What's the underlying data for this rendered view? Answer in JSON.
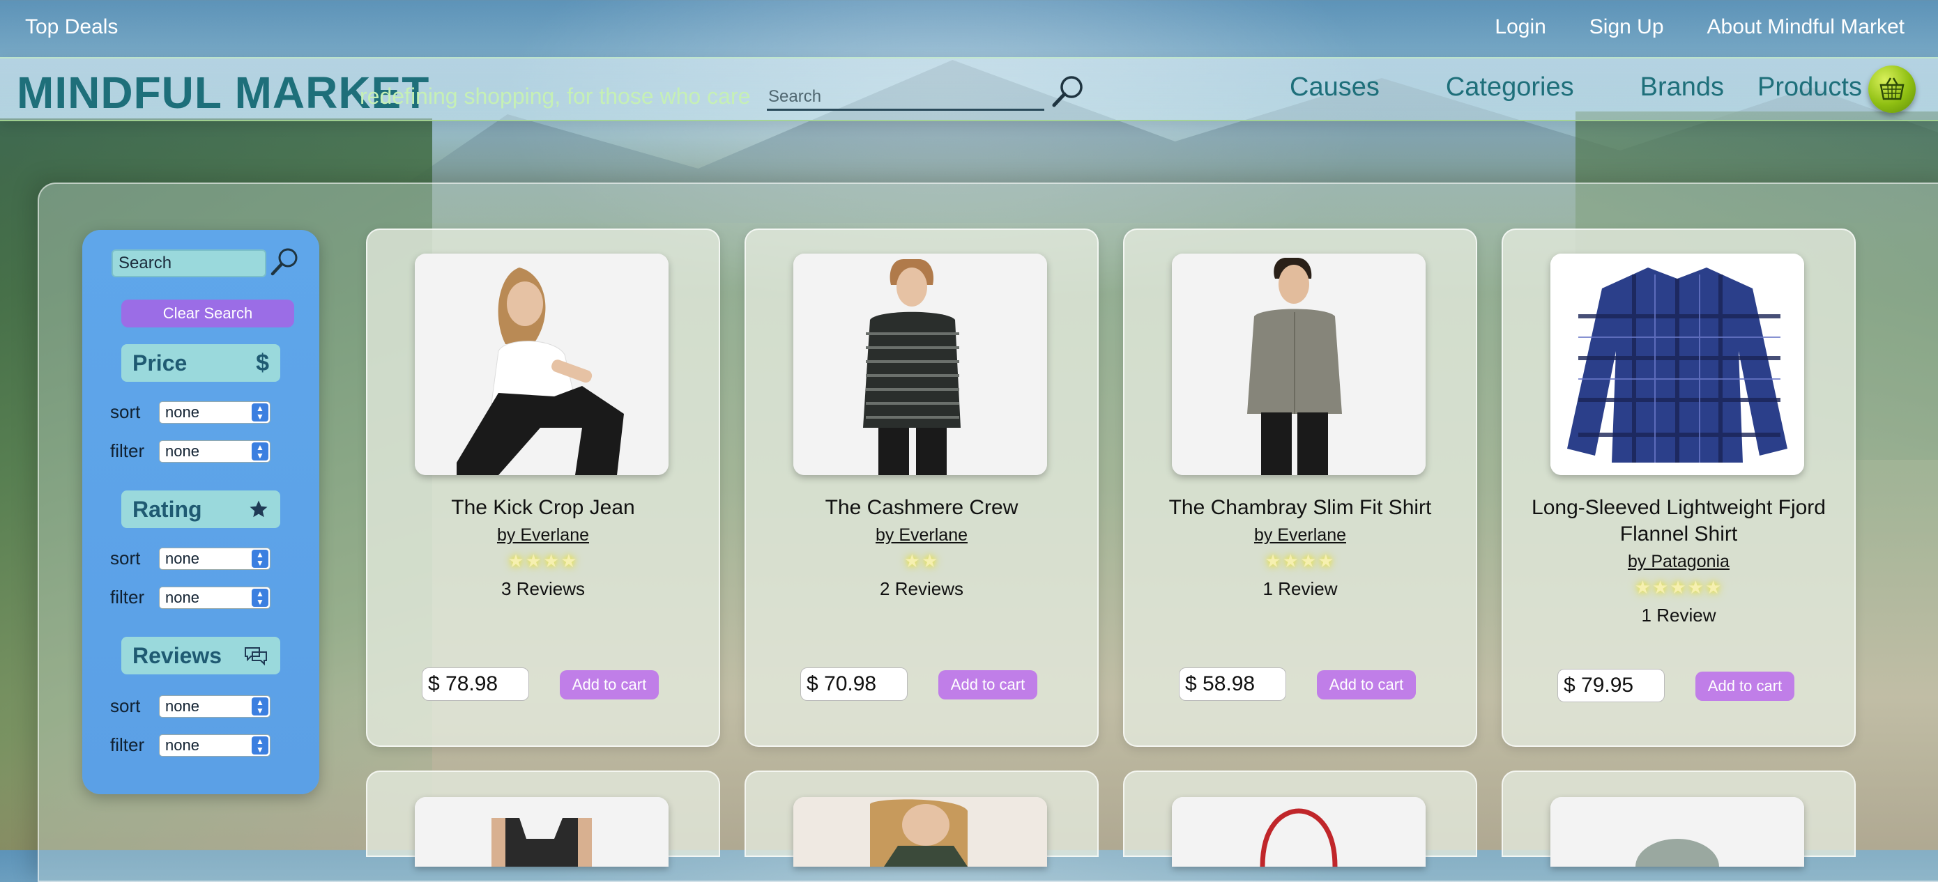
{
  "topbar": {
    "top_deals": "Top Deals",
    "login": "Login",
    "signup": "Sign Up",
    "about": "About Mindful Market"
  },
  "header": {
    "brand": "MINDFUL MARKET",
    "tagline": "redefining shopping, for those who care",
    "search_placeholder": "Search",
    "nav": [
      "Causes",
      "Categories",
      "Brands",
      "Products"
    ]
  },
  "sidebar": {
    "search_placeholder": "Search",
    "clear_label": "Clear Search",
    "sections": [
      {
        "title": "Price",
        "icon": "dollar-icon",
        "sort_label": "sort",
        "sort_value": "none",
        "filter_label": "filter",
        "filter_value": "none"
      },
      {
        "title": "Rating",
        "icon": "star-icon",
        "sort_label": "sort",
        "sort_value": "none",
        "filter_label": "filter",
        "filter_value": "none"
      },
      {
        "title": "Reviews",
        "icon": "chat-bubbles-icon",
        "sort_label": "sort",
        "sort_value": "none",
        "filter_label": "filter",
        "filter_value": "none"
      }
    ]
  },
  "products": [
    {
      "name": "The Kick Crop Jean",
      "brand": "by Everlane",
      "stars": 4,
      "reviews": "3 Reviews",
      "price": "$ 78.98",
      "add_label": "Add to cart"
    },
    {
      "name": "The Cashmere Crew",
      "brand": "by Everlane",
      "stars": 2,
      "reviews": "2 Reviews",
      "price": "$ 70.98",
      "add_label": "Add to cart"
    },
    {
      "name": "The Chambray Slim Fit Shirt",
      "brand": "by Everlane",
      "stars": 4,
      "reviews": "1 Review",
      "price": "$ 58.98",
      "add_label": "Add to cart"
    },
    {
      "name": "Long-Sleeved Lightweight Fjord Flannel Shirt",
      "brand": "by Patagonia",
      "stars": 5,
      "reviews": "1 Review",
      "price": "$ 79.95",
      "add_label": "Add to cart"
    }
  ],
  "colors": {
    "brand": "#1e6f7a",
    "tagline": "#c6f0b5",
    "sidebar": "#5fa6ea",
    "clear_button": "#9b6de6",
    "add_button": "#c07ee8",
    "cart": "#8fbf12"
  },
  "icons": {
    "header_search": "magnifier-icon",
    "cart": "basket-icon"
  }
}
